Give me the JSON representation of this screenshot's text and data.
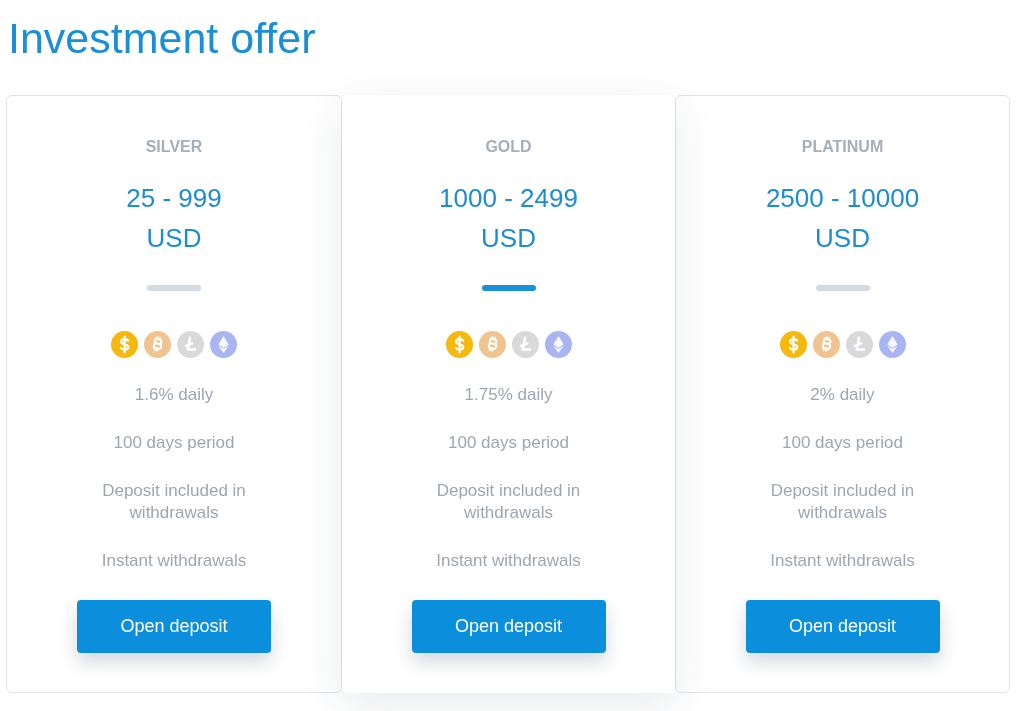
{
  "title": "Investment offer",
  "plans": [
    {
      "name": "SILVER",
      "range": "25 - 999",
      "currency": "USD",
      "featured": false,
      "features": [
        "1.6% daily",
        "100 days period",
        "Deposit included in withdrawals",
        "Instant withdrawals"
      ],
      "button": "Open deposit"
    },
    {
      "name": "GOLD",
      "range": "1000 - 2499",
      "currency": "USD",
      "featured": true,
      "features": [
        "1.75% daily",
        "100 days period",
        "Deposit included in withdrawals",
        "Instant withdrawals"
      ],
      "button": "Open deposit"
    },
    {
      "name": "PLATINUM",
      "range": "2500 - 10000",
      "currency": "USD",
      "featured": false,
      "features": [
        "2% daily",
        "100 days period",
        "Deposit included in withdrawals",
        "Instant withdrawals"
      ],
      "button": "Open deposit"
    }
  ]
}
